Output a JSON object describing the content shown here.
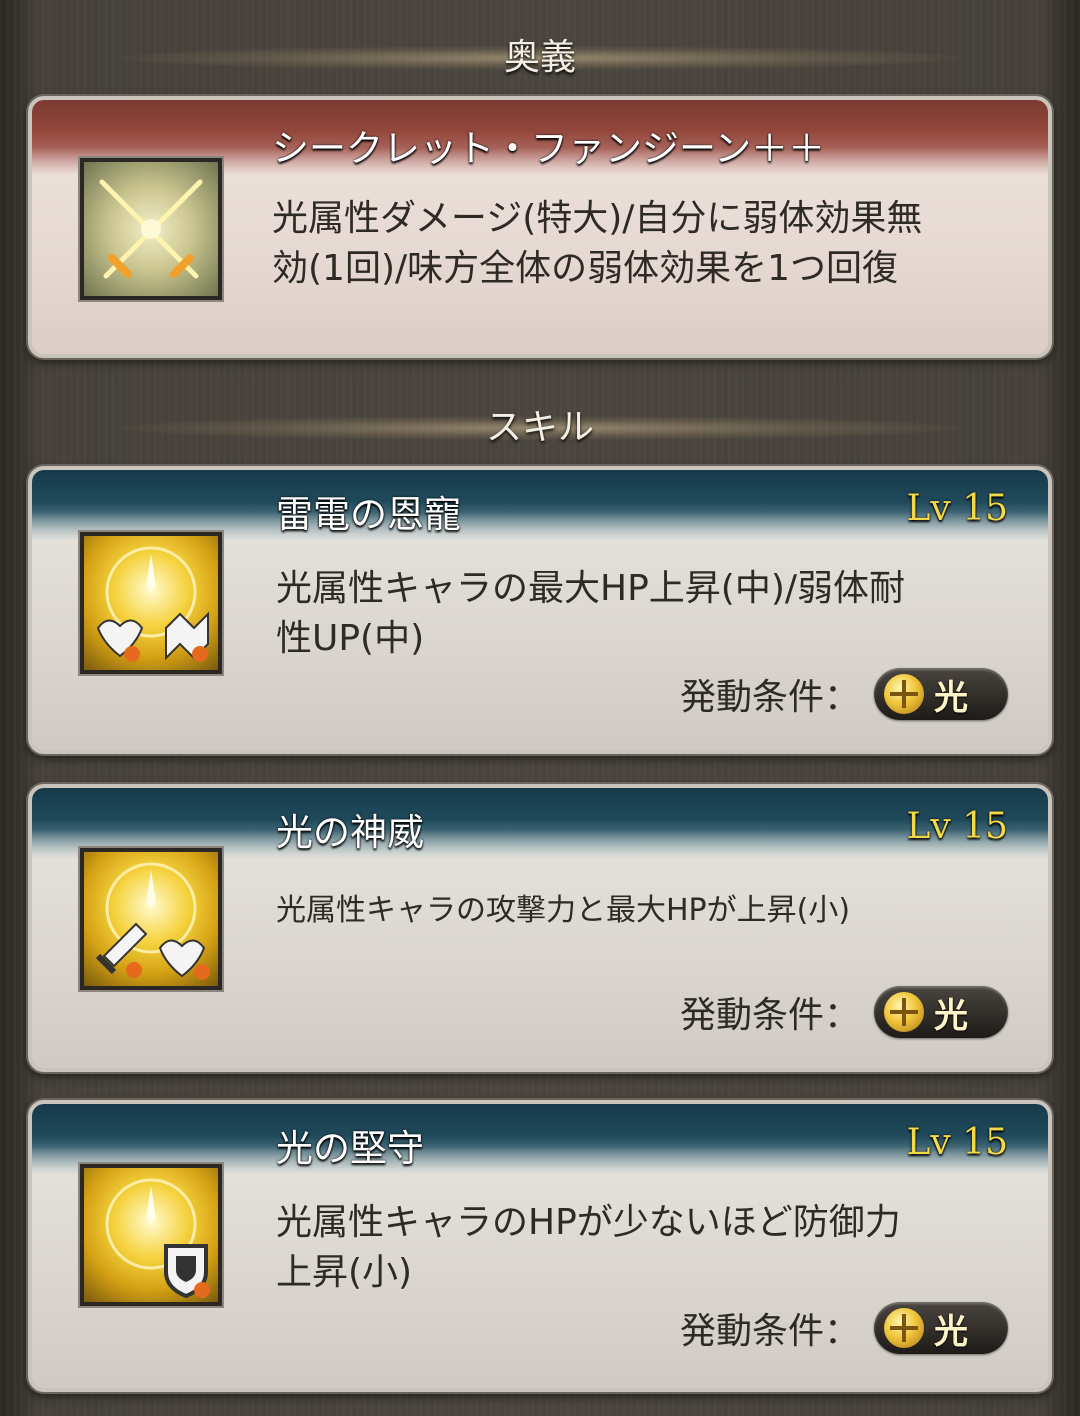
{
  "sections": {
    "ougi_header": "奥義",
    "skill_header": "スキル"
  },
  "ougi": {
    "name": "シークレット・ファンジーン＋＋",
    "icon": "crossed-swords-icon",
    "description_line1": "光属性ダメージ(特大)/自分に弱体効果無",
    "description_line2": "効(1回)/味方全体の弱体効果を1つ回復"
  },
  "skills": [
    {
      "name": "雷電の恩寵",
      "level": "Lv 15",
      "icon": "light-hp-debuff-resist-up-icon",
      "description_line1": "光属性キャラの最大HP上昇(中)/弱体耐",
      "description_line2": "性UP(中)",
      "condition_label": "発動条件：",
      "condition_value": "光"
    },
    {
      "name": "光の神威",
      "level": "Lv 15",
      "icon": "light-atk-hp-up-icon",
      "description_line1": "光属性キャラの攻撃力と最大HPが上昇(小)",
      "description_line2": "",
      "condition_label": "発動条件：",
      "condition_value": "光"
    },
    {
      "name": "光の堅守",
      "level": "Lv 15",
      "icon": "light-defense-up-icon",
      "description_line1": "光属性キャラのHPが少ないほど防御力",
      "description_line2": "上昇(小)",
      "condition_label": "発動条件：",
      "condition_value": "光"
    }
  ],
  "colors": {
    "level_text": "#f2d94a",
    "ougi_band": "#93463b",
    "skill_band": "#1f4a5b"
  }
}
